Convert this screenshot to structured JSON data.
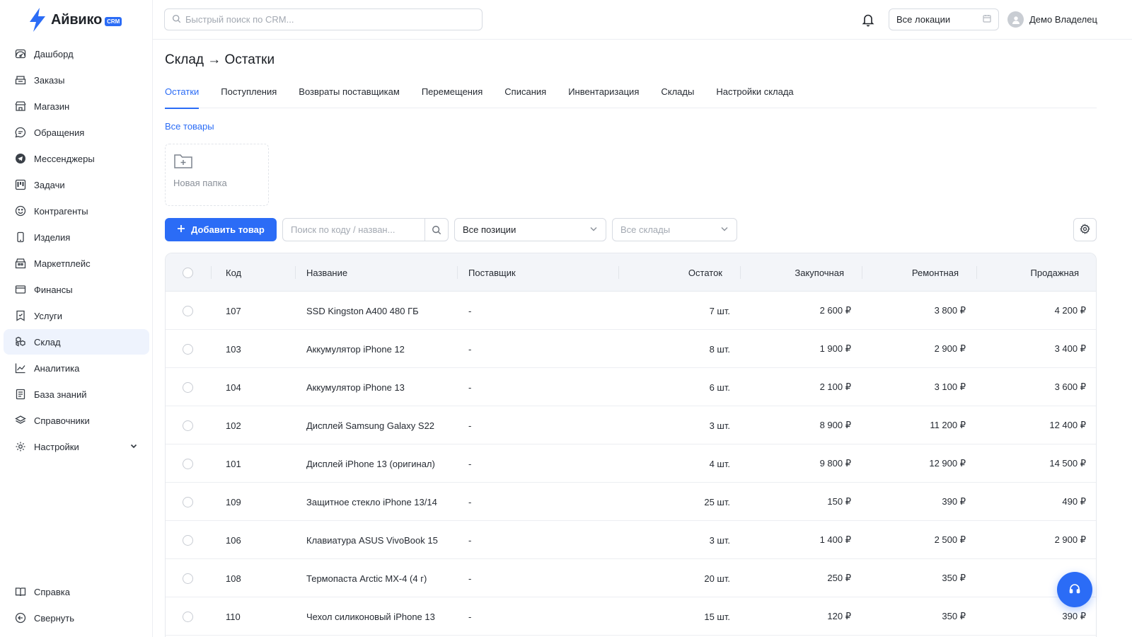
{
  "app": {
    "name": "Айвико",
    "badge": "CRM"
  },
  "header": {
    "search_placeholder": "Быстрый поиск по CRM...",
    "location": "Все локации",
    "user_name": "Демо Владелец"
  },
  "sidebar": {
    "items": [
      {
        "label": "Дашборд",
        "icon": "dashboard-icon"
      },
      {
        "label": "Заказы",
        "icon": "orders-icon"
      },
      {
        "label": "Магазин",
        "icon": "shop-icon"
      },
      {
        "label": "Обращения",
        "icon": "chat-icon"
      },
      {
        "label": "Мессенджеры",
        "icon": "telegram-icon"
      },
      {
        "label": "Задачи",
        "icon": "kanban-icon"
      },
      {
        "label": "Контрагенты",
        "icon": "smile-icon"
      },
      {
        "label": "Изделия",
        "icon": "phone-icon"
      },
      {
        "label": "Маркетплейс",
        "icon": "store-icon"
      },
      {
        "label": "Финансы",
        "icon": "wallet-icon"
      },
      {
        "label": "Услуги",
        "icon": "service-icon"
      },
      {
        "label": "Склад",
        "icon": "boxes-icon",
        "active": true
      },
      {
        "label": "Аналитика",
        "icon": "chart-icon"
      },
      {
        "label": "База знаний",
        "icon": "book-list-icon"
      },
      {
        "label": "Справочники",
        "icon": "layers-icon"
      },
      {
        "label": "Настройки",
        "icon": "gear-icon"
      }
    ],
    "bottom": [
      {
        "label": "Справка",
        "icon": "book-icon"
      },
      {
        "label": "Свернуть",
        "icon": "collapse-icon"
      }
    ]
  },
  "page": {
    "title": "Склад → Остатки",
    "tabs": [
      "Остатки",
      "Поступления",
      "Возвраты поставщикам",
      "Перемещения",
      "Списания",
      "Инвентаризация",
      "Склады",
      "Настройки склада"
    ],
    "active_tab": "Остатки",
    "all_products": "Все товары",
    "new_folder": "Новая папка"
  },
  "toolbar": {
    "add_label": "Добавить товар",
    "code_search_placeholder": "Поиск по коду / назван...",
    "positions": "Все позиции",
    "stores_placeholder": "Все склады"
  },
  "table": {
    "headers": [
      "Код",
      "Название",
      "Поставщик",
      "Остаток",
      "Закупочная",
      "Ремонтная",
      "Продажная"
    ],
    "rows": [
      [
        "107",
        "SSD Kingston A400 480 ГБ",
        "-",
        "7 шт.",
        "2 600 ₽",
        "3 800 ₽",
        "4 200 ₽"
      ],
      [
        "103",
        "Аккумулятор iPhone 12",
        "-",
        "8 шт.",
        "1 900 ₽",
        "2 900 ₽",
        "3 400 ₽"
      ],
      [
        "104",
        "Аккумулятор iPhone 13",
        "-",
        "6 шт.",
        "2 100 ₽",
        "3 100 ₽",
        "3 600 ₽"
      ],
      [
        "102",
        "Дисплей Samsung Galaxy S22",
        "-",
        "3 шт.",
        "8 900 ₽",
        "11 200 ₽",
        "12 400 ₽"
      ],
      [
        "101",
        "Дисплей iPhone 13 (оригинал)",
        "-",
        "4 шт.",
        "9 800 ₽",
        "12 900 ₽",
        "14 500 ₽"
      ],
      [
        "109",
        "Защитное стекло iPhone 13/14",
        "-",
        "25 шт.",
        "150 ₽",
        "390 ₽",
        "490 ₽"
      ],
      [
        "106",
        "Клавиатура ASUS VivoBook 15",
        "-",
        "3 шт.",
        "1 400 ₽",
        "2 500 ₽",
        "2 900 ₽"
      ],
      [
        "108",
        "Термопаста Arctic MX-4 (4 г)",
        "-",
        "20 шт.",
        "250 ₽",
        "350 ₽",
        ""
      ],
      [
        "110",
        "Чехол силиконовый iPhone 13",
        "-",
        "15 шт.",
        "120 ₽",
        "350 ₽",
        "390 ₽"
      ]
    ]
  },
  "colors": {
    "accent": "#2b6cf6",
    "active_bg": "#eef3fd",
    "header_bg": "#f3f5f9"
  }
}
